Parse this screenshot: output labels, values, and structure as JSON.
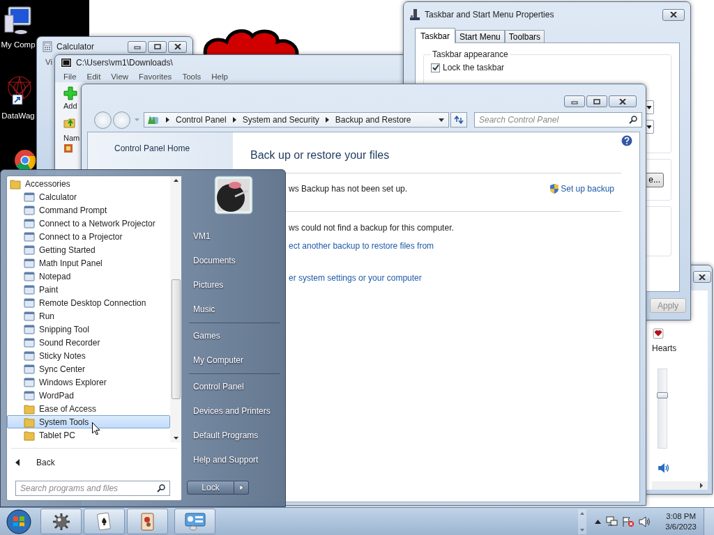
{
  "desktop_icons": [
    {
      "label": "My Comp",
      "kind": "computer"
    },
    {
      "label": "DataWag",
      "kind": "shortcut"
    }
  ],
  "calculator": {
    "title": "Calculator",
    "menu": [
      "Vi"
    ]
  },
  "archiver": {
    "title": "C:\\Users\\vm1\\Downloads\\",
    "menu": [
      "File",
      "Edit",
      "View",
      "Favorites",
      "Tools",
      "Help"
    ],
    "tool": "Add",
    "column": "Nam"
  },
  "properties": {
    "title": "Taskbar and Start Menu Properties",
    "tabs": [
      {
        "label": "Taskbar",
        "selected": true
      },
      {
        "label": "Start Menu",
        "selected": false
      },
      {
        "label": "Toolbars",
        "selected": false
      }
    ],
    "group": "Taskbar appearance",
    "options": [
      {
        "label": "Lock the taskbar",
        "checked": true
      }
    ],
    "button": "e...",
    "apply": {
      "label": "Apply",
      "disabled": true
    }
  },
  "hearts": {
    "label": "Hearts",
    "volume": {
      "level": 0.67
    }
  },
  "control_panel": {
    "breadcrumb": [
      "Control Panel",
      "System and Security",
      "Backup and Restore"
    ],
    "search": {
      "placeholder": "Search Control Panel"
    },
    "sidebar": [
      "Control Panel Home"
    ],
    "heading": "Back up or restore your files",
    "backup_status": "ws Backup has not been set up.",
    "setup_link": "Set up backup",
    "restore_status": "ws could not find a backup for this computer.",
    "restore_link": "ect another backup to restore files from",
    "recover_link": "er system settings or your computer"
  },
  "start_menu": {
    "programs": [
      {
        "label": "Accessories",
        "kind": "folder",
        "selected": false,
        "children": [
          {
            "label": "Calculator",
            "kind": "program",
            "selected": false
          },
          {
            "label": "Command Prompt",
            "kind": "program",
            "selected": false
          },
          {
            "label": "Connect to a Network Projector",
            "kind": "program",
            "selected": false
          },
          {
            "label": "Connect to a Projector",
            "kind": "program",
            "selected": false
          },
          {
            "label": "Getting Started",
            "kind": "program",
            "selected": false
          },
          {
            "label": "Math Input Panel",
            "kind": "program",
            "selected": false
          },
          {
            "label": "Notepad",
            "kind": "program",
            "selected": false
          },
          {
            "label": "Paint",
            "kind": "program",
            "selected": false
          },
          {
            "label": "Remote Desktop Connection",
            "kind": "program",
            "selected": false
          },
          {
            "label": "Run",
            "kind": "program",
            "selected": false
          },
          {
            "label": "Snipping Tool",
            "kind": "program",
            "selected": false
          },
          {
            "label": "Sound Recorder",
            "kind": "program",
            "selected": false
          },
          {
            "label": "Sticky Notes",
            "kind": "program",
            "selected": false
          },
          {
            "label": "Sync Center",
            "kind": "program",
            "selected": false
          },
          {
            "label": "Windows Explorer",
            "kind": "program",
            "selected": false
          },
          {
            "label": "WordPad",
            "kind": "program",
            "selected": false
          },
          {
            "label": "Ease of Access",
            "kind": "folder",
            "selected": false
          },
          {
            "label": "System Tools",
            "kind": "folder",
            "selected": true
          },
          {
            "label": "Tablet PC",
            "kind": "folder",
            "selected": false
          }
        ]
      }
    ],
    "back": "Back",
    "search": {
      "placeholder": "Search programs and files"
    },
    "places": [
      [
        "VM1",
        "Documents",
        "Pictures",
        "Music"
      ],
      [
        "Games",
        "My Computer"
      ],
      [
        "Control Panel",
        "Devices and Printers",
        "Default Programs",
        "Help and Support"
      ]
    ],
    "lock": "Lock"
  },
  "taskbar": {
    "apps": [
      {
        "kind": "gear"
      },
      {
        "kind": "cards"
      },
      {
        "kind": "tile"
      },
      {
        "kind": "panel"
      }
    ],
    "clock": {
      "time": "3:08 PM",
      "date": "3/6/2023"
    }
  }
}
